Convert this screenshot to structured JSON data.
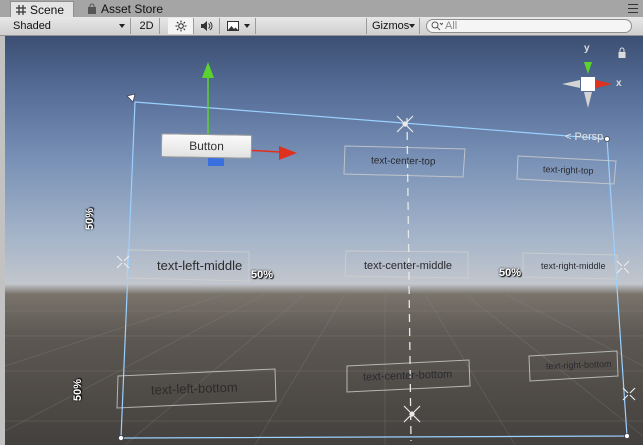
{
  "tabs": [
    {
      "label": "Scene",
      "icon": "hash-grid-icon",
      "active": true
    },
    {
      "label": "Asset Store",
      "icon": "shopping-bag-icon",
      "active": false
    }
  ],
  "toolbar": {
    "shading_mode": "Shaded",
    "mode_2d": "2D",
    "gizmos_label": "Gizmos",
    "search_placeholder": "All"
  },
  "scene": {
    "button_label": "Button",
    "texts": {
      "center_top": "text-center-top",
      "right_top": "text-right-top",
      "left_middle": "text-left-middle",
      "center_middle": "text-center-middle",
      "right_middle": "text-right-middle",
      "left_bottom": "text-left-bottom",
      "center_bottom": "text-center-bottom",
      "right_bottom": "text-right-bottom"
    },
    "percent_labels": {
      "left_upper": "50%",
      "middle": "50%",
      "right": "50%",
      "left_lower": "50%"
    },
    "orientation": {
      "y_label": "y",
      "x_label": "x",
      "projection": "Persp"
    }
  },
  "colors": {
    "rect_outline": "#9bd0ff",
    "axis_x": "#e0301e",
    "axis_y": "#5bd32f",
    "axis_z": "#3a6fe0"
  }
}
